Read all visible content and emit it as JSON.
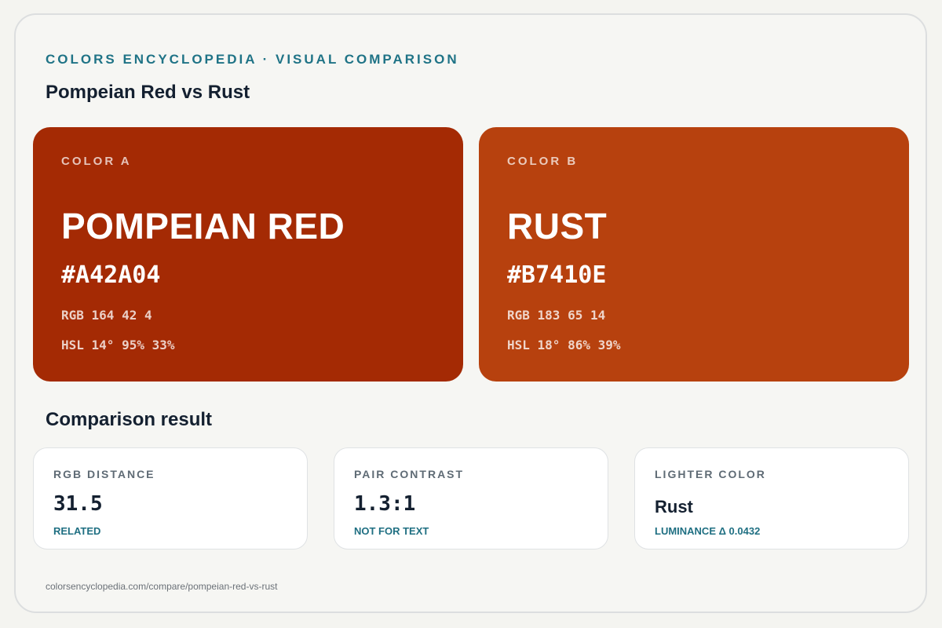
{
  "header": {
    "eyebrow": "COLORS ENCYCLOPEDIA · VISUAL COMPARISON",
    "title": "Pompeian Red vs Rust"
  },
  "colors": [
    {
      "kicker": "COLOR A",
      "name": "POMPEIAN RED",
      "hex": "#A42A04",
      "rgb": "RGB 164 42 4",
      "hsl": "HSL 14° 95% 33%",
      "swatch_color": "#A42A04"
    },
    {
      "kicker": "COLOR B",
      "name": "RUST",
      "hex": "#B7410E",
      "rgb": "RGB 183 65 14",
      "hsl": "HSL 18° 86% 39%",
      "swatch_color": "#B7410E"
    }
  ],
  "comparison": {
    "title": "Comparison result",
    "cards": [
      {
        "label": "RGB DISTANCE",
        "value": "31.5",
        "note": "RELATED"
      },
      {
        "label": "PAIR CONTRAST",
        "value": "1.3:1",
        "note": "NOT FOR TEXT"
      },
      {
        "label": "LIGHTER COLOR",
        "value": "Rust",
        "note": "LUMINANCE Δ 0.0432"
      }
    ]
  },
  "footer": {
    "url": "colorsencyclopedia.com/compare/pompeian-red-vs-rust"
  },
  "theme": {
    "accent": "#1f7386",
    "background": "#f6f6f3",
    "ink": "#142030"
  }
}
